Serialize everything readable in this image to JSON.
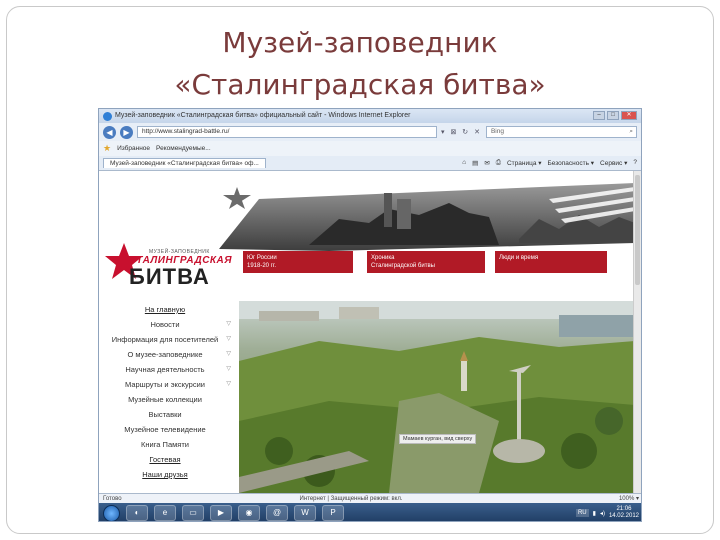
{
  "slide": {
    "title_line1": "Музей-заповедник",
    "title_line2": "«Сталинградская битва»"
  },
  "browser": {
    "window_title": "Музей-заповедник «Сталинградская битва» официальный сайт - Windows Internet Explorer",
    "url": "http://www.stalingrad-battle.ru/",
    "url_tools": "▾ ⊠ ↻ ✕",
    "search_placeholder": "Bing",
    "favorites_label": "Избранное",
    "favorites_item": "Рекомендуемые...",
    "tab_label": "Музей-заповедник «Сталинградская битва» оф...",
    "commands": [
      "Страница ▾",
      "Безопасность ▾",
      "Сервис ▾",
      "?"
    ],
    "status_left": "Готово",
    "status_zone": "Интернет | Защищенный режим: вкл.",
    "status_zoom": "100% ▾"
  },
  "site": {
    "logo_small": "МУЗЕЙ-ЗАПОВЕДНИК",
    "logo_line1": "СТАЛИНГРАДСКАЯ",
    "logo_line2": "БИТВА",
    "banner_blocks": [
      {
        "text1": "Юг России",
        "text2": "1918-20 гг."
      },
      {
        "text1": "Хроника",
        "text2": "Сталинградской битвы"
      },
      {
        "text1": "Люди и время",
        "text2": ""
      }
    ],
    "menu": [
      {
        "label": "На главную",
        "arrow": ""
      },
      {
        "label": "Новости",
        "arrow": "▽"
      },
      {
        "label": "Информация для посетителей",
        "arrow": "▽"
      },
      {
        "label": "О музее-заповеднике",
        "arrow": "▽"
      },
      {
        "label": "Научная деятельность",
        "arrow": "▽"
      },
      {
        "label": "Маршруты и экскурсии",
        "arrow": "▽"
      },
      {
        "label": "Музейные коллекции",
        "arrow": ""
      },
      {
        "label": "Выставки",
        "arrow": ""
      },
      {
        "label": "Музейное телевидение",
        "arrow": ""
      },
      {
        "label": "Книга Памяти",
        "arrow": ""
      },
      {
        "label": "Гостевая",
        "arrow": ""
      },
      {
        "label": "Наши друзья",
        "arrow": ""
      }
    ],
    "photo_caption": "Мамаев курган, вид сверху"
  },
  "taskbar": {
    "lang": "RU",
    "time": "21:06",
    "date": "14.02.2012"
  },
  "colors": {
    "title": "#7a3b3b",
    "brand_red": "#b11a26",
    "taskbar": "#1f3c63"
  }
}
